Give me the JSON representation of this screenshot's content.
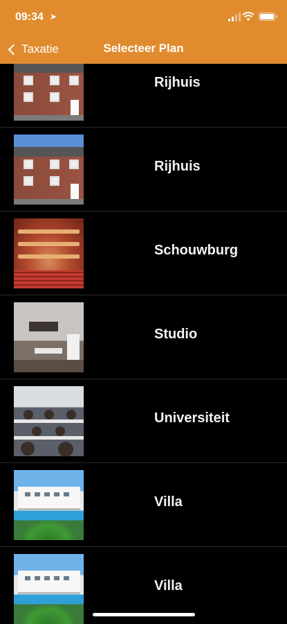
{
  "status_bar": {
    "time": "09:34",
    "location_icon": "location-arrow-icon",
    "signal_icon": "cellular-signal-icon",
    "wifi_icon": "wifi-icon",
    "battery_icon": "battery-icon"
  },
  "nav": {
    "back_label": "Taxatie",
    "title": "Selecteer Plan",
    "accent_color": "#e08c2e"
  },
  "plans": [
    {
      "label": "Rijhuis",
      "thumbnail": "terraced-house-photo"
    },
    {
      "label": "Rijhuis",
      "thumbnail": "terraced-house-photo"
    },
    {
      "label": "Schouwburg",
      "thumbnail": "theatre-interior-photo"
    },
    {
      "label": "Studio",
      "thumbnail": "studio-apartment-photo"
    },
    {
      "label": "Universiteit",
      "thumbnail": "lecture-hall-photo"
    },
    {
      "label": "Villa",
      "thumbnail": "villa-with-pool-photo"
    },
    {
      "label": "Villa",
      "thumbnail": "villa-with-pool-photo"
    }
  ]
}
